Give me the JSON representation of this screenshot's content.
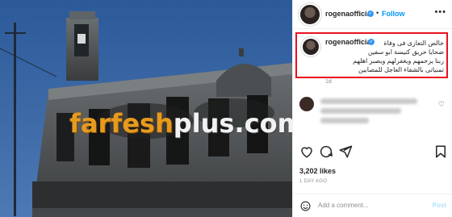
{
  "post": {
    "username": "rogenaofficial",
    "follow_label": "Follow",
    "dot": "•",
    "more_label": "•••",
    "caption_lines": [
      "خالص التعازى فى وفاة",
      "ضحايا حريق كنيسة ابو سفين",
      "ربنا يرحمهم ويغفرلهم ويصبر اهلهم",
      "تمنياتى بالشفاء العاجل للمصابين"
    ],
    "caption_age": "1d",
    "likes": "3,202 likes",
    "timestamp": "1 DAY AGO",
    "comment_placeholder": "Add a comment...",
    "post_label": "Post"
  },
  "photo": {
    "watermark_part1": "farfesh",
    "watermark_part2": "plus.com"
  },
  "icons": {
    "verified": "verified-badge-icon",
    "heart": "heart-icon",
    "comment": "comment-icon",
    "share": "share-icon",
    "save": "bookmark-icon",
    "emoji": "emoji-icon",
    "more": "more-options-icon"
  },
  "colors": {
    "link_blue": "#0095f6",
    "verified_blue": "#3897f0",
    "highlight_red": "#e8121f",
    "sky": "#2f5f9e",
    "watermark_orange": "#e69a1f"
  }
}
